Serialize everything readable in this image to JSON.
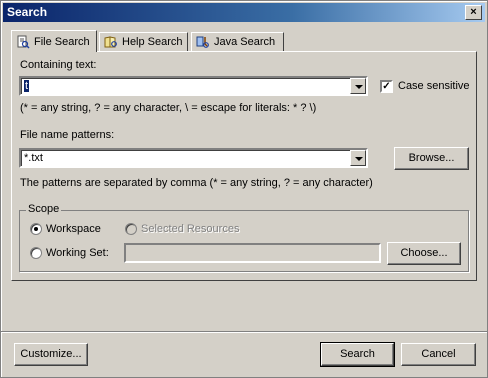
{
  "window": {
    "title": "Search",
    "close_glyph": "×"
  },
  "tabs": [
    {
      "label": "File Search",
      "icon": "file-search-icon",
      "active": true
    },
    {
      "label": "Help Search",
      "icon": "help-search-icon",
      "active": false
    },
    {
      "label": "Java Search",
      "icon": "java-search-icon",
      "active": false
    }
  ],
  "containing": {
    "label": "Containing text:",
    "value": "t",
    "case_sensitive_label": "Case sensitive",
    "case_sensitive_checked": true,
    "hint": "(* = any string, ? = any character, \\ = escape for literals: * ? \\)"
  },
  "file_patterns": {
    "label": "File name patterns:",
    "value": "*.txt",
    "browse_label": "Browse...",
    "hint": "The patterns are separated by comma (* = any string, ? = any character)"
  },
  "scope": {
    "legend": "Scope",
    "workspace_label": "Workspace",
    "workspace_selected": true,
    "selected_resources_label": "Selected Resources",
    "working_set_label": "Working Set:",
    "working_set_value": "",
    "choose_label": "Choose..."
  },
  "footer": {
    "customize_label": "Customize...",
    "search_label": "Search",
    "cancel_label": "Cancel"
  }
}
